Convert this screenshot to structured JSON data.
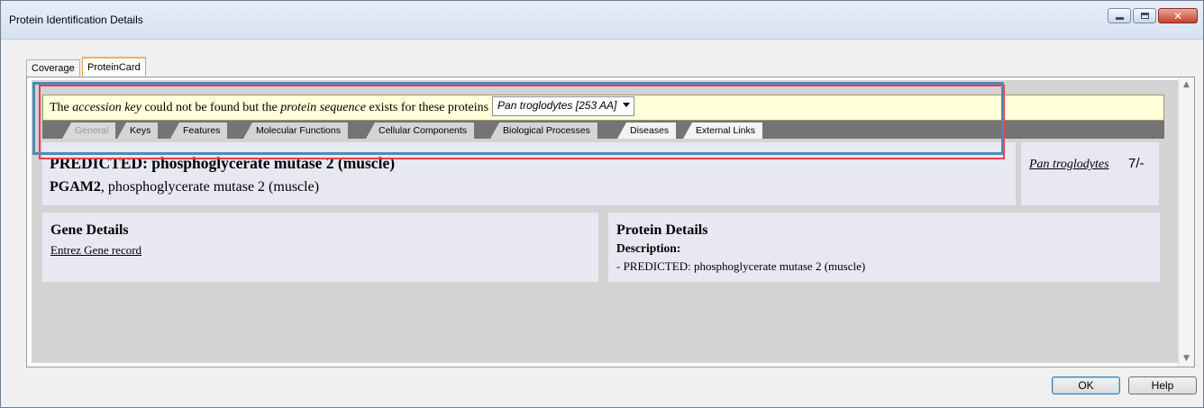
{
  "window": {
    "title": "Protein Identification Details",
    "buttons": {
      "minimize_icon": "minimize-icon",
      "maximize_icon": "maximize-icon",
      "close_icon": "close-icon",
      "close_glyph": "✕"
    }
  },
  "tabs": [
    {
      "label": "Coverage",
      "active": false
    },
    {
      "label": "ProteinCard",
      "active": true
    }
  ],
  "notice": {
    "prefix": "The ",
    "key_term": "accession key",
    "middle": " could not be found but the ",
    "seq_term": "protein sequence",
    "suffix": " exists for these proteins",
    "species_selected": "Pan troglodytes [253 AA]"
  },
  "subtabs": [
    "General",
    "Keys",
    "Features",
    "Molecular Functions",
    "Cellular Components",
    "Biological Processes",
    "Diseases",
    "External Links"
  ],
  "protein": {
    "title": "PREDICTED: phosphoglycerate mutase 2 (muscle)",
    "gene_symbol": "PGAM2",
    "gene_desc": ", phosphoglycerate mutase 2 (muscle)",
    "species_link": "Pan troglodytes",
    "species_count": "7/-"
  },
  "gene_details": {
    "heading": "Gene Details",
    "link": "Entrez Gene record"
  },
  "protein_details": {
    "heading": "Protein Details",
    "desc_label": "Description:",
    "desc_text": "- PREDICTED: phosphoglycerate mutase 2 (muscle)"
  },
  "footer": {
    "ok_label": "OK",
    "help_label": "Help"
  },
  "colors": {
    "notice_bg": "#ffffd9",
    "subtab_bar": "#747474",
    "card_bg": "#e8e8f2",
    "highlight_red": "#e8404a",
    "highlight_blue": "#4f8ab6"
  }
}
